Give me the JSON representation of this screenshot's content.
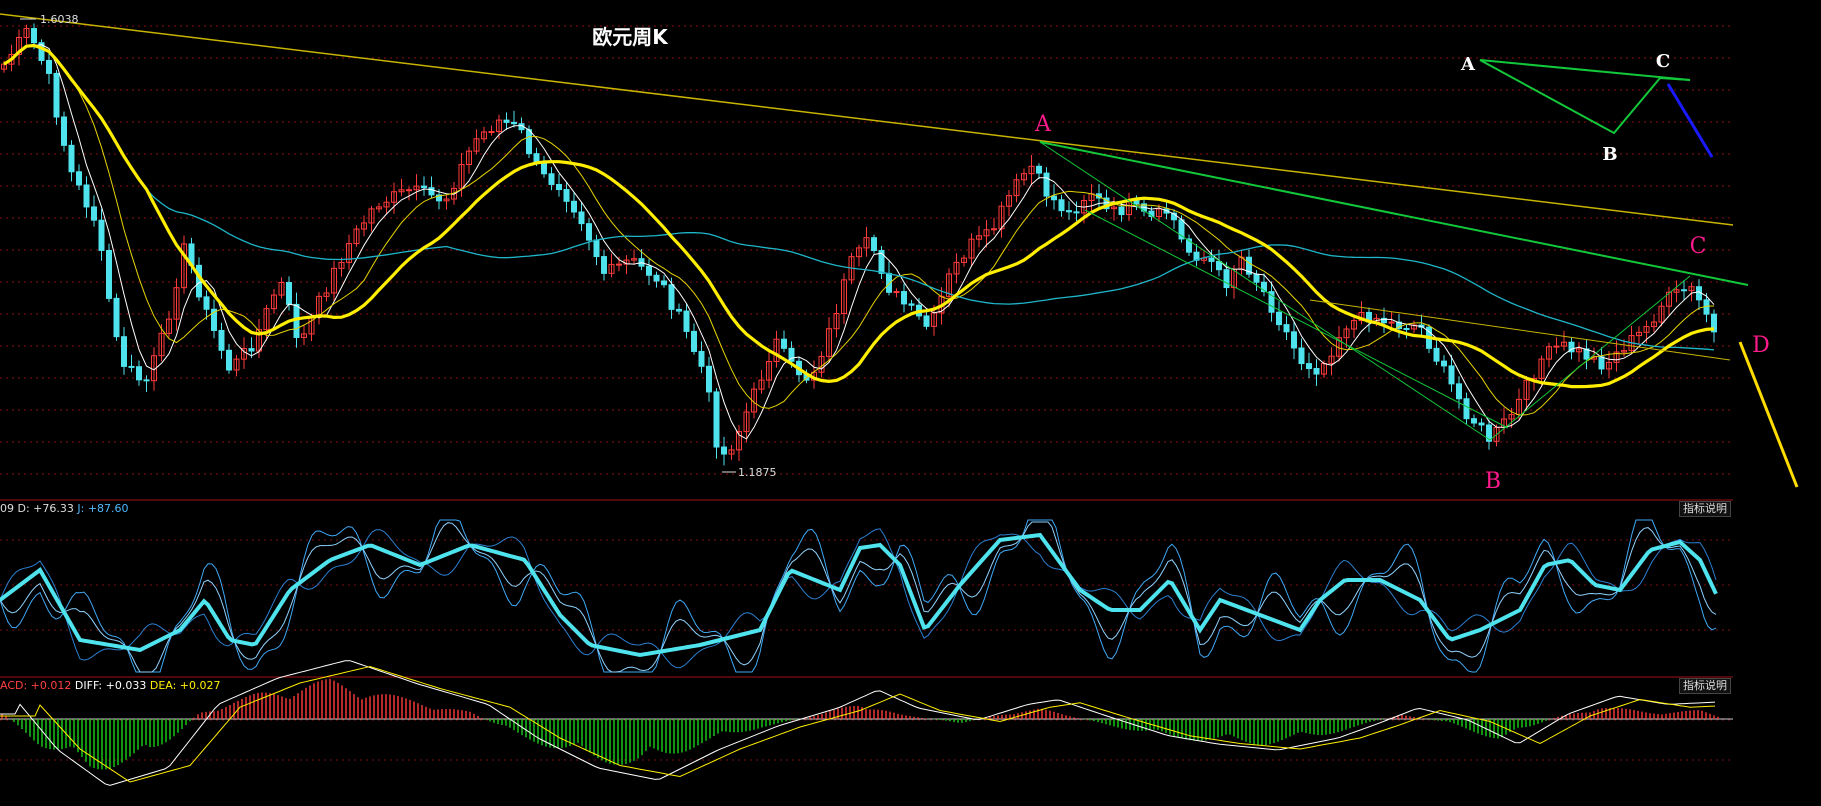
{
  "chart_data": [
    {
      "type": "candlestick",
      "title": "欧元周K",
      "price_high_label": "1.6038",
      "price_low_label": "1.1875",
      "ylim": [
        1.15,
        1.64
      ],
      "wave_labels_main": [
        "A",
        "B",
        "C",
        "D"
      ],
      "wave_labels_legend": [
        "A",
        "B",
        "C"
      ],
      "colors": {
        "up": "#ff3b3b",
        "down": "#4fe3ee",
        "ma_slow": "#ffee00",
        "ma_long": "#1fb6c9",
        "trend": "#c8b400",
        "channel": "#12c83a",
        "label": "#ff1a8c",
        "projection": "#ffdd00",
        "legend_arrow": "#1a1aff"
      }
    },
    {
      "type": "line",
      "indicator": "KDJ",
      "header_k": "09",
      "header_d": "D: +76.33",
      "header_j": "J: +87.60",
      "ylim": [
        0,
        100
      ],
      "button": "指标说明"
    },
    {
      "type": "bar",
      "indicator": "MACD",
      "header_macd": "ACD: +0.012",
      "header_diff": "DIFF: +0.033",
      "header_dea": "DEA: +0.027",
      "button": "指标说明"
    }
  ]
}
